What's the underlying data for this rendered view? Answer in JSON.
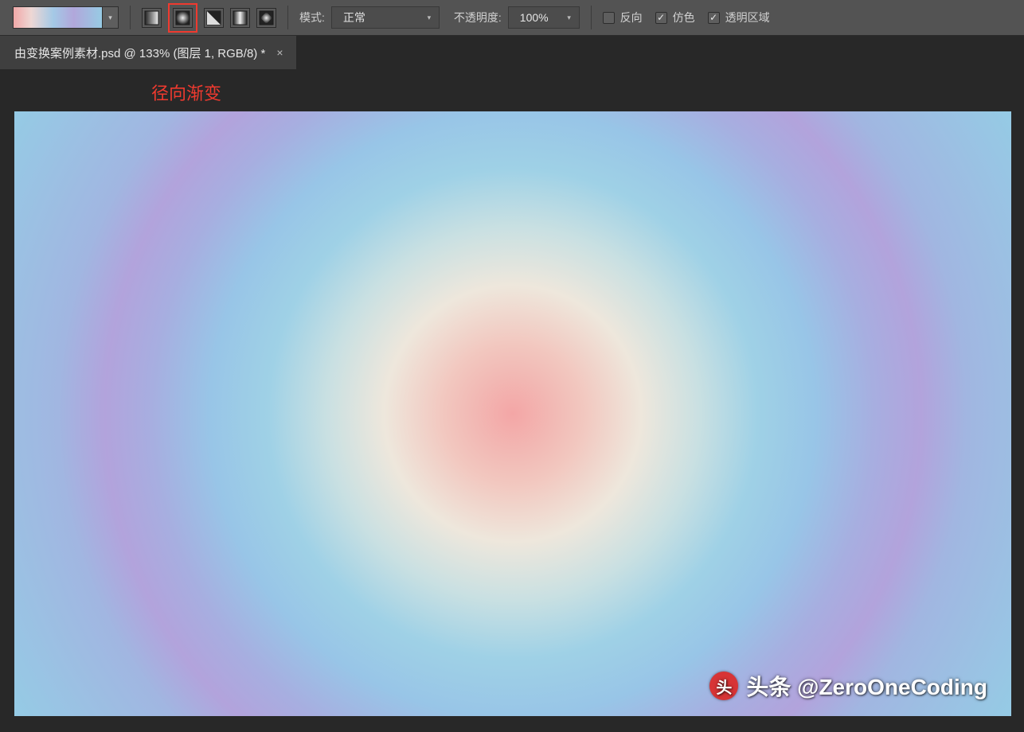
{
  "options_bar": {
    "mode_label": "模式:",
    "mode_value": "正常",
    "opacity_label": "不透明度:",
    "opacity_value": "100%",
    "reverse_label": "反向",
    "dither_label": "仿色",
    "transparency_label": "透明区域",
    "reverse_checked": false,
    "dither_checked": true,
    "transparency_checked": true,
    "gradient_types": [
      "linear",
      "radial",
      "angle",
      "reflected",
      "diamond"
    ],
    "gradient_type_selected": "radial"
  },
  "tab": {
    "title": "由变换案例素材.psd @ 133% (图层 1, RGB/8) *"
  },
  "annotation": {
    "text": "径向渐变"
  },
  "watermark": {
    "text": "头条 @ZeroOneCoding"
  }
}
